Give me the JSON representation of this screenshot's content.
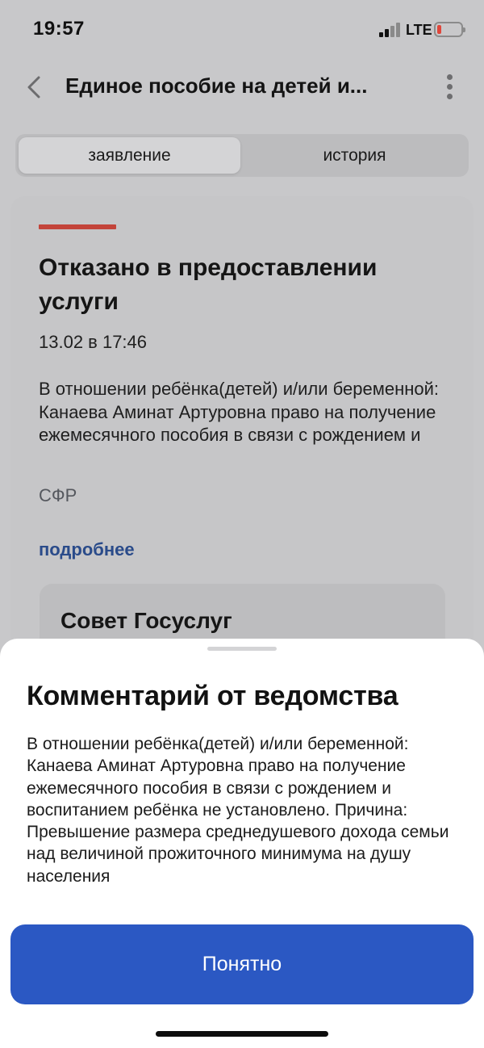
{
  "status_bar": {
    "time": "19:57",
    "network": "LTE",
    "battery_color": "#e0463a"
  },
  "header": {
    "title": "Единое пособие на детей и...",
    "back_icon": "chevron-left-icon",
    "menu_icon": "more-vertical-icon"
  },
  "tabs": [
    {
      "label": "заявление",
      "active": true
    },
    {
      "label": "история",
      "active": false
    }
  ],
  "card": {
    "status_color": "#c3443a",
    "title": "Отказано в предоставлении услуги",
    "date": "13.02 в 17:46",
    "text": "В отношении ребёнка(детей) и/или беременной: Канаева Аминат Артуровна право на получение ежемесячного пособия в связи с рождением и",
    "source": "СФР",
    "more_link": "подробнее",
    "advice_title": "Совет Госуслуг"
  },
  "sheet": {
    "title": "Комментарий от ведомства",
    "text": "В отношении ребёнка(детей) и/или беременной: Канаева Аминат Артуровна право на получение ежемесячного пособия в связи с рождением и воспитанием ребёнка не установлено. Причина: Превышение размера среднедушевого дохода семьи над величиной прожиточного минимума на душу населения",
    "button_label": "Понятно",
    "button_color": "#2b58c3"
  }
}
